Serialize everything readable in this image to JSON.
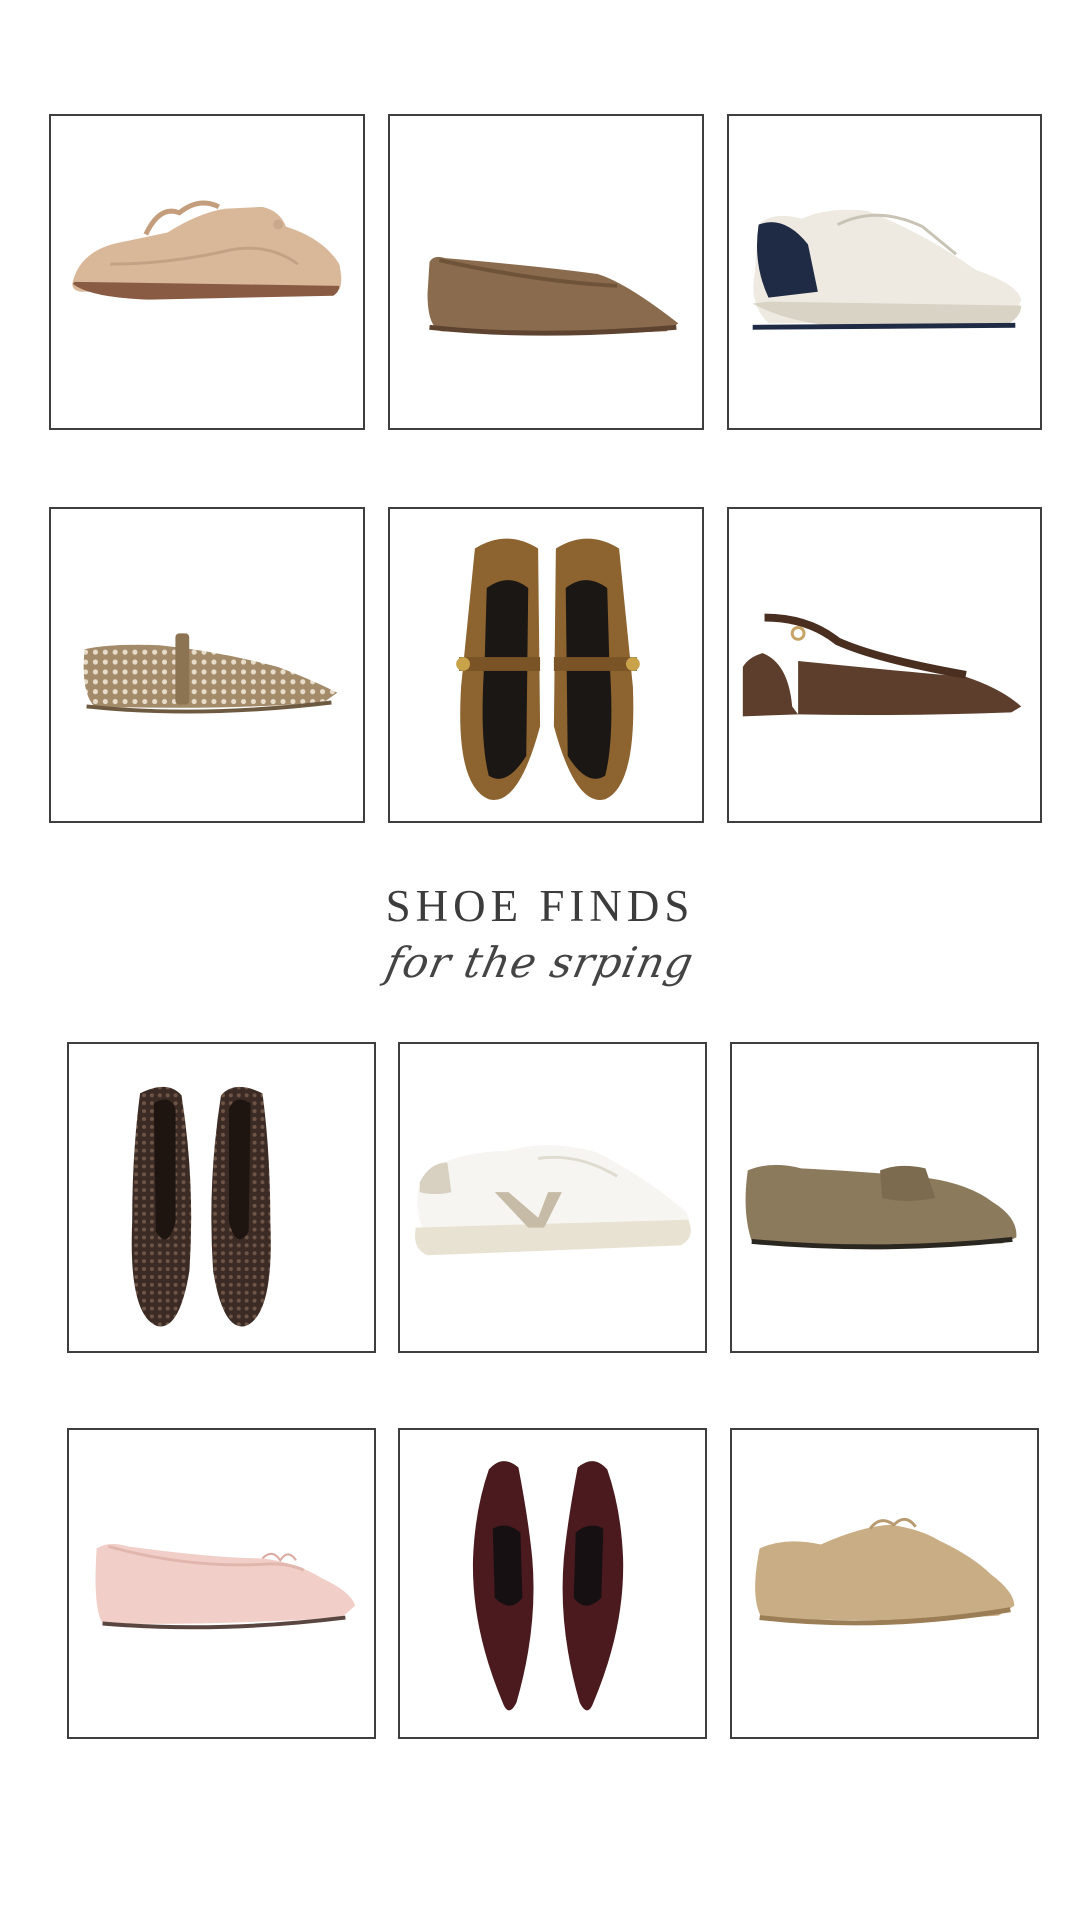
{
  "heading": {
    "title": "SHOE FINDS",
    "subtitle": "for the srping"
  },
  "products": [
    {
      "name": "tan-suede-sneaker",
      "color": "#d7b79a"
    },
    {
      "name": "brown-suede-ballet-flat",
      "color": "#8a6b4d"
    },
    {
      "name": "white-navy-runner",
      "color": "#e9e6df"
    },
    {
      "name": "perforated-mary-jane",
      "color": "#9c8466"
    },
    {
      "name": "brown-suede-mary-jane-pair",
      "color": "#8a5f2c"
    },
    {
      "name": "brown-slingback-heel",
      "color": "#5a3b2a"
    },
    {
      "name": "woven-ballet-flat-pair",
      "color": "#3e2f28"
    },
    {
      "name": "white-veja-sneaker",
      "color": "#f4f2ee"
    },
    {
      "name": "olive-suede-loafer",
      "color": "#8c7a5d"
    },
    {
      "name": "pink-suede-ballet-flat",
      "color": "#f1cfc8"
    },
    {
      "name": "burgundy-croc-slingback-pair",
      "color": "#4a1a1f"
    },
    {
      "name": "beige-suede-lace-up",
      "color": "#c9ad84"
    }
  ]
}
